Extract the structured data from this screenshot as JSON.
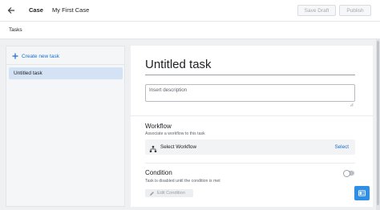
{
  "header": {
    "case_label": "Case",
    "case_title": "My First Case",
    "save_draft": "Save Draft",
    "publish": "Publish"
  },
  "subheader": {
    "tasks": "Tasks"
  },
  "sidebar": {
    "create_new_task": "Create new task",
    "items": [
      {
        "label": "Untitled task",
        "selected": true
      }
    ]
  },
  "task": {
    "title": "Untitled task",
    "description_placeholder": "Insert description"
  },
  "workflow": {
    "title": "Workflow",
    "subtitle": "Associate a workflow to this task",
    "select_placeholder": "Select Workflow",
    "select_link": "Select"
  },
  "condition": {
    "title": "Condition",
    "subtitle": "Task is disabled until the condition is met",
    "toggle_on": false,
    "edit_button": "Edit Condition"
  },
  "colors": {
    "accent": "#1a6dd1",
    "selected_bg": "#d3e3f5",
    "fab": "#2f8fe6"
  },
  "icons": [
    "back-arrow-icon",
    "plus-icon",
    "workflow-tree-icon",
    "pencil-icon",
    "book-icon"
  ]
}
